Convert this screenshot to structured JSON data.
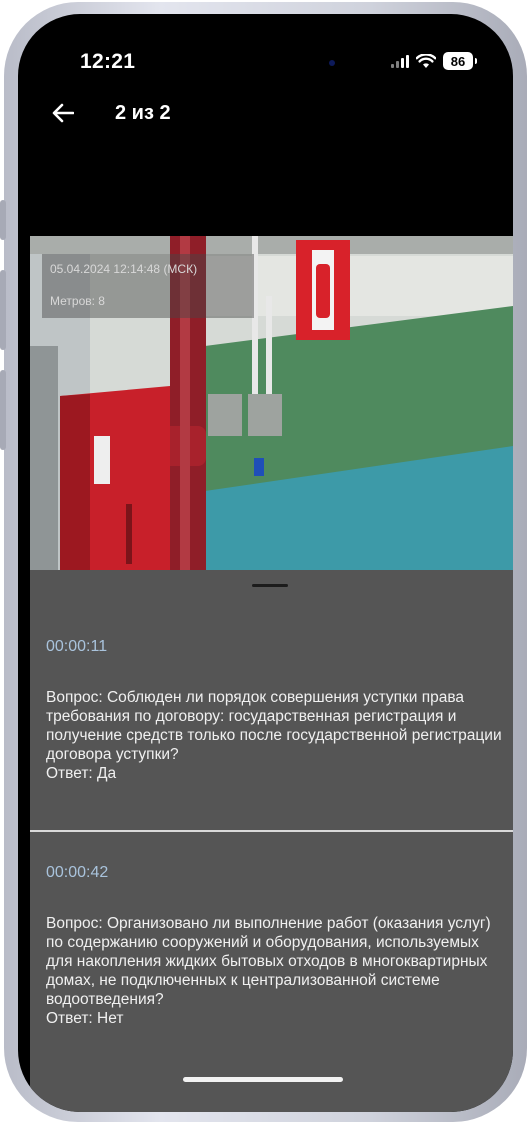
{
  "status_bar": {
    "time": "12:21",
    "battery": "86"
  },
  "header": {
    "title": "2 из 2"
  },
  "photo": {
    "timestamp": "05.04.2024 12:14:48 (МСК)",
    "distance": "Метров: 8"
  },
  "entries": [
    {
      "time": "00:00:11",
      "question": "Вопрос: Соблюден ли порядок совершения уступки права требования по договору: государственная регистрация и получение средств только после государственной регистрации договора уступки?",
      "answer": "Ответ: Да"
    },
    {
      "time": "00:00:42",
      "question": "Вопрос: Организовано ли выполнение работ (оказания услуг) по содержанию сооружений и оборудования, используемых для накопления жидких бытовых отходов в многоквартирных домах, не подключенных к централизованной системе водоотведения?",
      "answer": "Ответ: Нет"
    }
  ],
  "colors": {
    "screen_bg": "#000000",
    "sheet_bg": "#555555",
    "time_accent": "#a9c3dc",
    "text": "#f0f0f0"
  },
  "icons": [
    "back-arrow-icon",
    "signal-icon",
    "wifi-icon",
    "battery-icon"
  ]
}
